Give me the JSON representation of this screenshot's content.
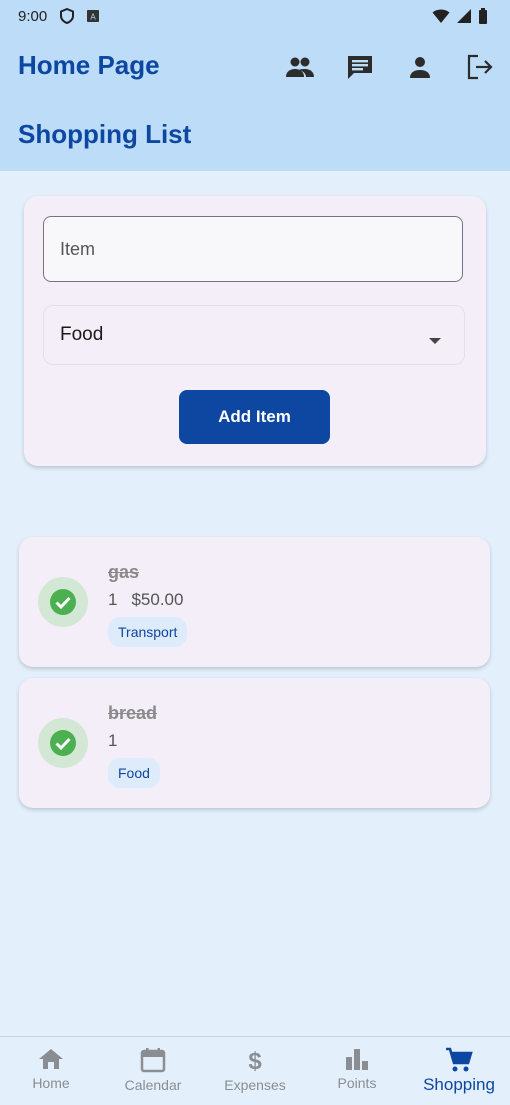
{
  "status_bar": {
    "time": "9:00"
  },
  "header": {
    "title": "Home Page",
    "actions": [
      "group-icon",
      "chat-icon",
      "person-icon",
      "logout-icon"
    ]
  },
  "section": {
    "title": "Shopping List"
  },
  "form": {
    "item_placeholder": "Item",
    "category_value": "Food",
    "add_button_label": "Add Item"
  },
  "items": [
    {
      "name": "gas",
      "quantity": "1",
      "price": "$50.00",
      "category": "Transport",
      "done": true
    },
    {
      "name": "bread",
      "quantity": "1",
      "price": "",
      "category": "Food",
      "done": true
    }
  ],
  "bottom_nav": {
    "items": [
      {
        "label": "Home",
        "icon": "home-icon"
      },
      {
        "label": "Calendar",
        "icon": "calendar-icon"
      },
      {
        "label": "Expenses",
        "icon": "dollar-icon"
      },
      {
        "label": "Points",
        "icon": "bar-chart-icon"
      },
      {
        "label": "Shopping",
        "icon": "cart-icon",
        "active": true
      }
    ]
  },
  "colors": {
    "primary": "#0d47a1",
    "header_bg": "#bcdcf8",
    "page_bg": "#e3f0fc",
    "card_bg": "#f4eef8",
    "check_green": "#4caf50"
  }
}
